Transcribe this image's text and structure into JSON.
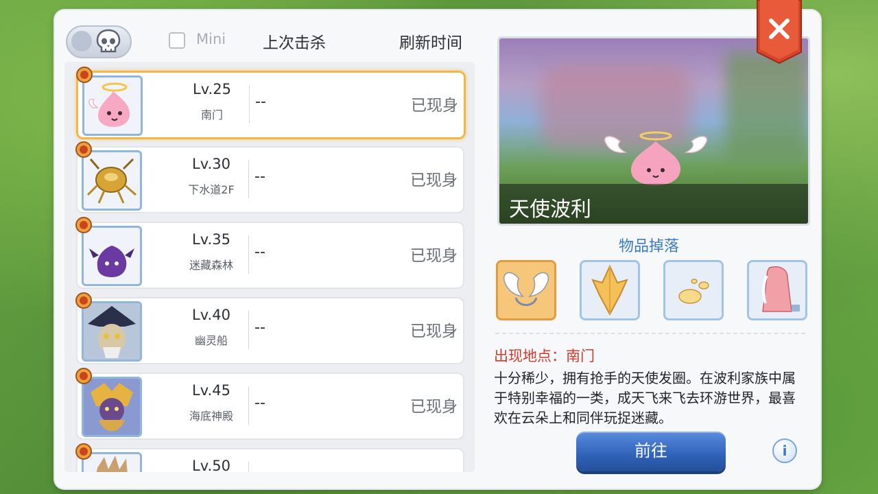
{
  "header": {
    "mini_label": "Mini",
    "col_last_kill": "上次击杀",
    "col_refresh": "刷新时间"
  },
  "rows": [
    {
      "level": "Lv.25",
      "location": "南门",
      "last_kill": "--",
      "status": "已现身",
      "monster": "angeling-icon"
    },
    {
      "level": "Lv.30",
      "location": "下水道2F",
      "last_kill": "--",
      "status": "已现身",
      "monster": "golden-thief-bug-icon"
    },
    {
      "level": "Lv.35",
      "location": "迷藏森林",
      "last_kill": "--",
      "status": "已现身",
      "monster": "deviling-icon"
    },
    {
      "level": "Lv.40",
      "location": "幽灵船",
      "last_kill": "--",
      "status": "已现身",
      "monster": "drake-icon"
    },
    {
      "level": "Lv.45",
      "location": "海底神殿",
      "last_kill": "--",
      "status": "已现身",
      "monster": "strouf-icon"
    },
    {
      "level": "Lv.50",
      "location": "",
      "last_kill": "",
      "status": "",
      "monster": "partial-mvp-icon"
    }
  ],
  "detail": {
    "monster_name": "天使波利",
    "drops_title": "物品掉落",
    "drops": [
      {
        "icon": "angel-wing-headband-icon"
      },
      {
        "icon": "crystal-shard-icon"
      },
      {
        "icon": "jellopy-icon"
      },
      {
        "icon": "robe-card-icon"
      }
    ],
    "location_line": "出现地点：南门",
    "description": "十分稀少，拥有抢手的天使发圈。在波利家族中属于特别幸福的一类，成天飞来飞去环游世界，最喜欢在云朵上和同伴玩捉迷藏。",
    "go_button": "前往",
    "info_button": "i"
  },
  "colors": {
    "accent_blue": "#3a7bc4",
    "selected_border": "#f2b845",
    "location_red": "#d33a2c",
    "close_red": "#d8442a"
  }
}
